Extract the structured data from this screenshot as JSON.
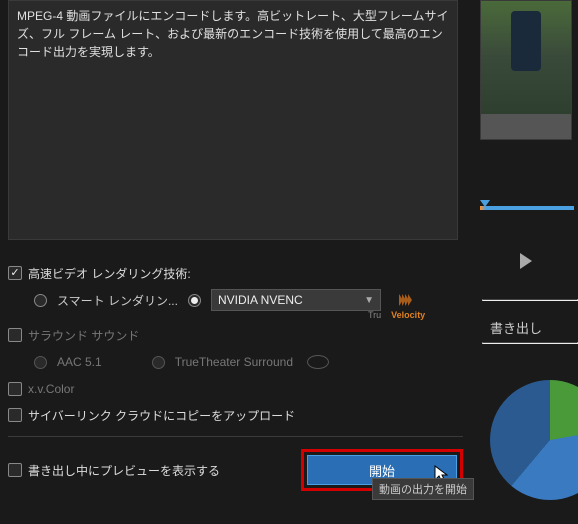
{
  "description": "MPEG-4 動画ファイルにエンコードします。高ビットレート、大型フレームサイズ、フル フレーム レート、および最新のエンコード技術を使用して最高のエンコード出力を実現します。",
  "highspeed": {
    "label": "高速ビデオ レンダリング技術:",
    "smart": "スマート レンダリン...",
    "encoder_selected": "NVIDIA NVENC",
    "velocity_prefix": "Tru",
    "velocity_word": "Velocity"
  },
  "surround": {
    "label": "サラウンド サウンド",
    "aac": "AAC 5.1",
    "truetheater": "TrueTheater Surround"
  },
  "xvcolor": {
    "label": "x.v.Color"
  },
  "cyberlink_cloud": {
    "label": "サイバーリンク クラウドにコピーをアップロード"
  },
  "preview_during_export": {
    "label": "書き出し中にプレビューを表示する"
  },
  "start_button": "開始",
  "tooltip": "動画の出力を開始",
  "right_section_title": "書き出し"
}
